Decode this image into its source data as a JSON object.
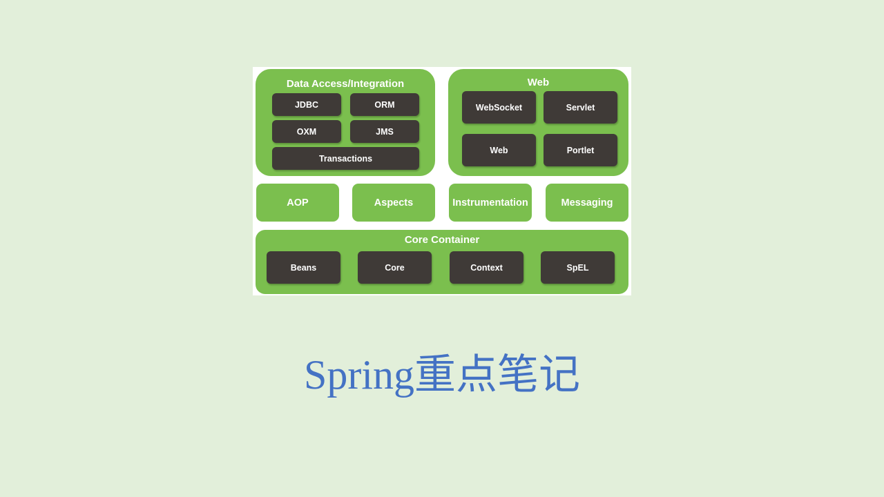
{
  "diagram": {
    "data_access": {
      "title": "Data Access/Integration",
      "modules": [
        "JDBC",
        "ORM",
        "OXM",
        "JMS",
        "Transactions"
      ]
    },
    "web": {
      "title": "Web",
      "modules": [
        "WebSocket",
        "Servlet",
        "Web",
        "Portlet"
      ]
    },
    "middle": [
      "AOP",
      "Aspects",
      "Instrumentation",
      "Messaging"
    ],
    "core_container": {
      "title": "Core Container",
      "modules": [
        "Beans",
        "Core",
        "Context",
        "SpEL"
      ]
    }
  },
  "slide": {
    "title": "Spring重点笔记"
  },
  "colors": {
    "background": "#e2efda",
    "panel_green": "#7bbf4e",
    "module_dark": "#3f3a37",
    "title_blue": "#4472c4"
  }
}
